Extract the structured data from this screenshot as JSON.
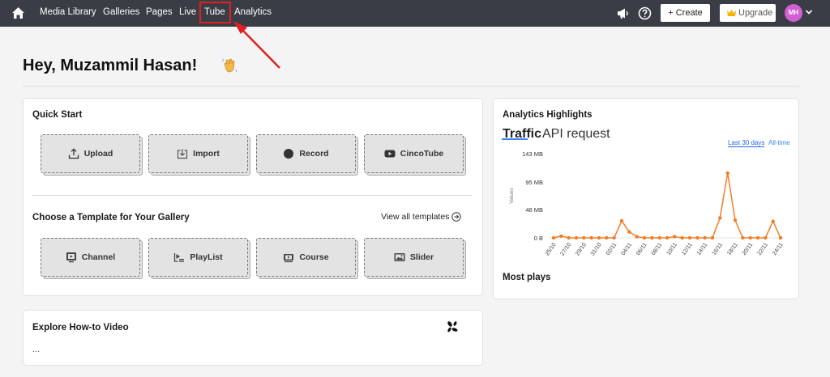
{
  "nav": {
    "links": [
      "Media Library",
      "Galleries",
      "Pages",
      "Live",
      "Tube",
      "Analytics"
    ],
    "create_label": "+ Create",
    "upgrade_label": "Upgrade",
    "avatar_initials": "MH",
    "highlight_color": "#e02020"
  },
  "greeting": "Hey, Muzammil Hasan!",
  "quick_start": {
    "title": "Quick Start",
    "tiles": [
      {
        "label": "Upload",
        "icon": "upload-icon"
      },
      {
        "label": "Import",
        "icon": "import-icon"
      },
      {
        "label": "Record",
        "icon": "record-icon"
      },
      {
        "label": "CincoTube",
        "icon": "youtube-icon"
      }
    ]
  },
  "templates": {
    "title": "Choose a Template for Your Gallery",
    "view_all": "View all templates",
    "tiles": [
      {
        "label": "Channel",
        "icon": "channel-icon"
      },
      {
        "label": "PlayList",
        "icon": "playlist-icon"
      },
      {
        "label": "Course",
        "icon": "course-icon"
      },
      {
        "label": "Slider",
        "icon": "slider-icon"
      }
    ]
  },
  "howto": {
    "title": "Explore How-to Video",
    "placeholder": "..."
  },
  "analytics": {
    "title": "Analytics Highlights",
    "tabs": [
      "Traffic",
      "API request"
    ],
    "ranges": [
      "Last 30 days",
      "All-time"
    ],
    "most_plays": "Most plays"
  },
  "chart_data": {
    "type": "line",
    "ylabel": "Values",
    "yticks": [
      "143 MB",
      "95 MB",
      "48 MB",
      "0 B"
    ],
    "ylim": [
      0,
      143
    ],
    "line_color": "#f07e26",
    "x": [
      "25/10",
      "26/10",
      "27/10",
      "28/10",
      "29/10",
      "30/10",
      "31/10",
      "01/11",
      "02/11",
      "03/11",
      "04/11",
      "05/11",
      "06/11",
      "07/11",
      "08/11",
      "09/11",
      "10/11",
      "11/11",
      "12/11",
      "13/11",
      "14/11",
      "15/11",
      "16/11",
      "17/11",
      "18/11",
      "19/11",
      "20/11",
      "21/11",
      "22/11",
      "23/11",
      "24/11"
    ],
    "xticks": [
      "25/10",
      "27/10",
      "29/10",
      "31/10",
      "02/11",
      "04/11",
      "06/11",
      "08/11",
      "10/11",
      "12/11",
      "14/11",
      "16/11",
      "18/11",
      "20/11",
      "22/11",
      "24/11"
    ],
    "values": [
      0,
      3,
      0,
      0,
      0,
      0,
      0,
      0,
      0,
      29,
      10,
      2,
      0,
      0,
      0,
      0,
      2,
      0,
      0,
      0,
      0,
      0,
      34,
      110,
      30,
      0,
      0,
      0,
      0,
      28,
      0
    ]
  }
}
